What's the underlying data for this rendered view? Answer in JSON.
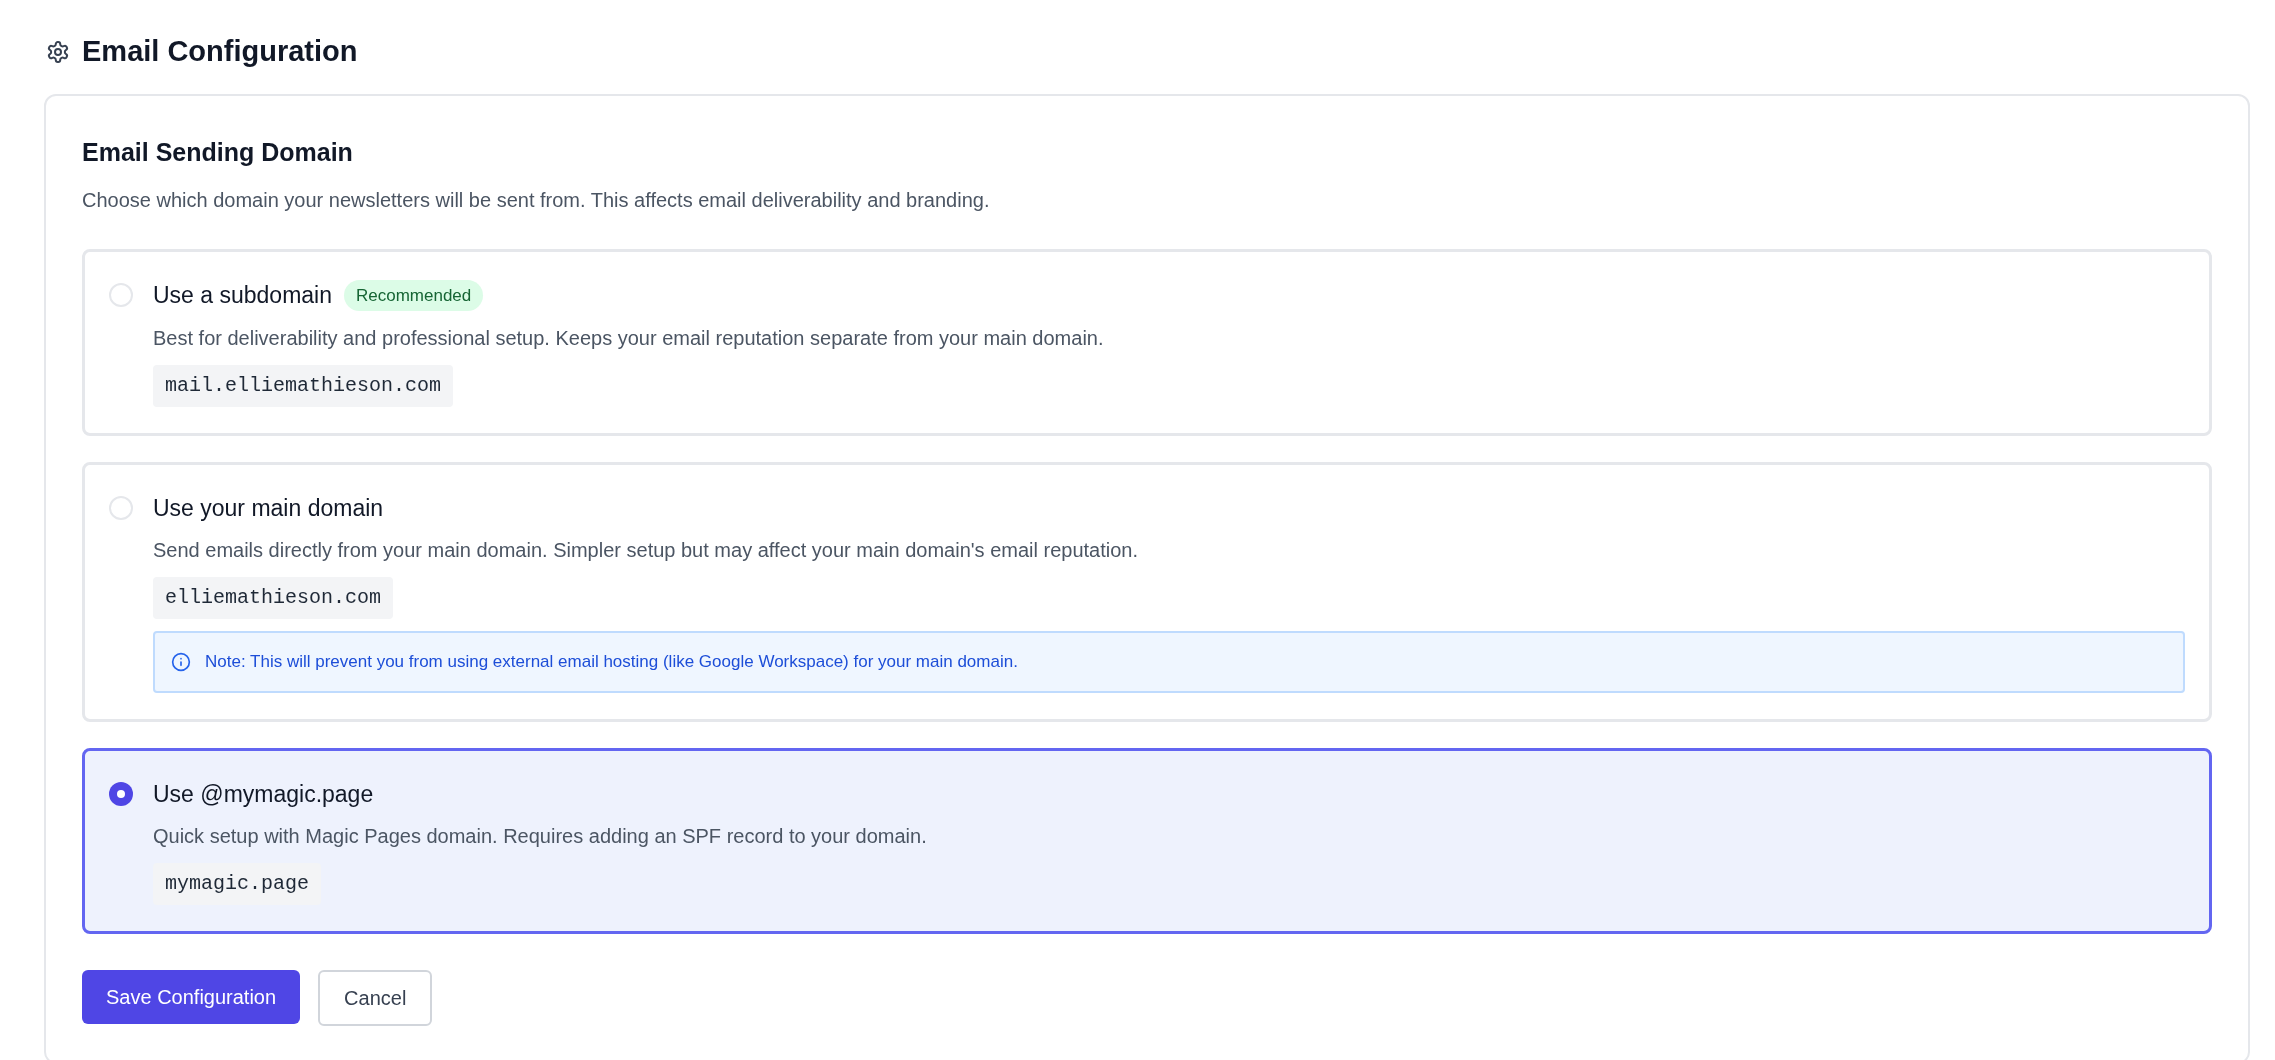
{
  "page": {
    "title": "Email Configuration"
  },
  "section": {
    "title": "Email Sending Domain",
    "description": "Choose which domain your newsletters will be sent from. This affects email deliverability and branding."
  },
  "options": [
    {
      "label": "Use a subdomain",
      "badge": "Recommended",
      "description": "Best for deliverability and professional setup. Keeps your email reputation separate from your main domain.",
      "domain": "mail.elliemathieson.com",
      "selected": false
    },
    {
      "label": "Use your main domain",
      "description": "Send emails directly from your main domain. Simpler setup but may affect your main domain's email reputation.",
      "domain": "elliemathieson.com",
      "note": "Note: This will prevent you from using external email hosting (like Google Workspace) for your main domain.",
      "selected": false
    },
    {
      "label": "Use @mymagic.page",
      "description": "Quick setup with Magic Pages domain. Requires adding an SPF record to your domain.",
      "domain": "mymagic.page",
      "selected": true
    }
  ],
  "buttons": [
    {
      "label": "Save Configuration",
      "kind": "primary"
    },
    {
      "label": "Cancel",
      "kind": "secondary"
    }
  ]
}
